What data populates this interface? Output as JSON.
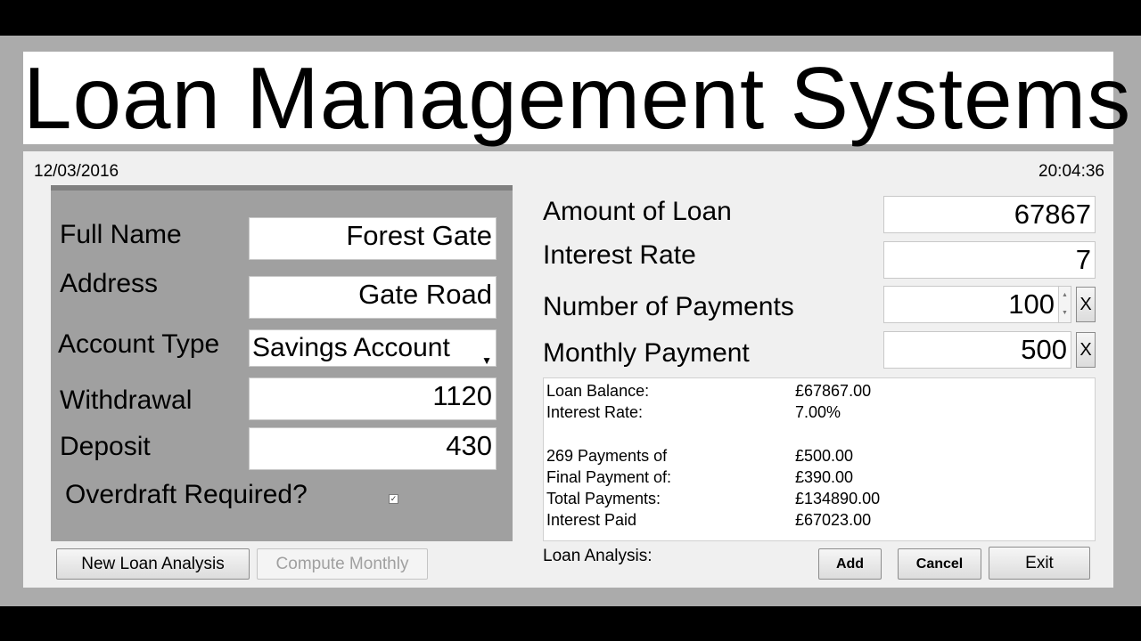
{
  "title": "Loan Management Systems",
  "date": "12/03/2016",
  "time": "20:04:36",
  "customer": {
    "full_name_label": "Full Name",
    "full_name_value": "Forest Gate",
    "address_label": "Address",
    "address_value": "Gate Road",
    "account_type_label": "Account Type",
    "account_type_value": "Savings Account",
    "withdrawal_label": "Withdrawal",
    "withdrawal_value": "1120",
    "deposit_label": "Deposit",
    "deposit_value": "430",
    "overdraft_label": "Overdraft Required?",
    "overdraft_checked": "✓"
  },
  "loan": {
    "amount_label": "Amount of Loan",
    "amount_value": "67867",
    "interest_label": "Interest Rate",
    "interest_value": "7",
    "payments_label": "Number of Payments",
    "payments_value": "100",
    "monthly_label": "Monthly Payment",
    "monthly_value": "500",
    "clear_label": "X"
  },
  "summary": {
    "rows": [
      {
        "label": "Loan Balance:",
        "value": "£67867.00"
      },
      {
        "label": "Interest Rate:",
        "value": "7.00%"
      },
      {
        "label": "269 Payments of",
        "value": "£500.00"
      },
      {
        "label": "Final Payment of:",
        "value": "£390.00"
      },
      {
        "label": "Total Payments:",
        "value": "£134890.00"
      },
      {
        "label": "Interest Paid",
        "value": "£67023.00"
      }
    ],
    "footer_label": "Loan Analysis:"
  },
  "buttons": {
    "new_loan": "New Loan Analysis",
    "compute_monthly": "Compute Monthly",
    "add": "Add",
    "cancel": "Cancel",
    "exit": "Exit"
  },
  "icons": {
    "combo_arrow": "chevron-down-icon",
    "spin": "spin-arrows-icon"
  }
}
